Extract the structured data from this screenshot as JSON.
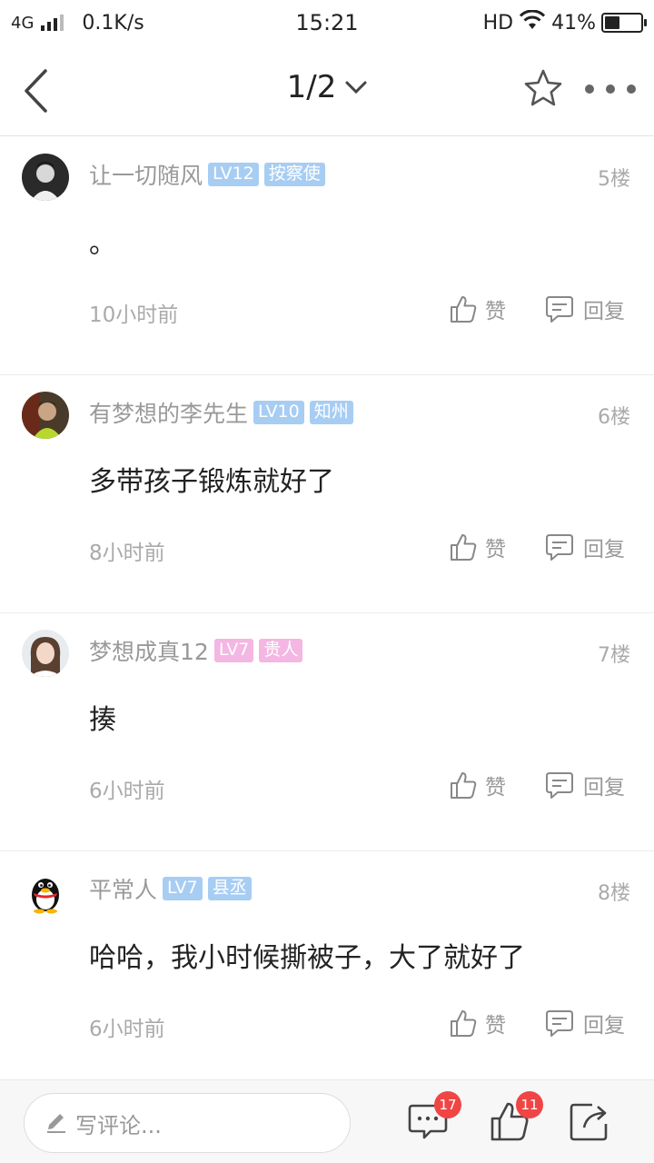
{
  "status_bar": {
    "network": "4G",
    "speed": "0.1K/s",
    "time": "15:21",
    "hd": "HD",
    "battery": "41%",
    "battery_level": 0.41
  },
  "header": {
    "page_indicator": "1/2"
  },
  "comments": [
    {
      "username": "让一切随风",
      "level": "LV12",
      "title": "按察使",
      "badge_color": "#a7cdf3",
      "floor": "5楼",
      "content": "。",
      "time": "10小时前",
      "like_label": "赞",
      "reply_label": "回复"
    },
    {
      "username": "有梦想的李先生",
      "level": "LV10",
      "title": "知州",
      "badge_color": "#a7cdf3",
      "floor": "6楼",
      "content": "多带孩子锻炼就好了",
      "time": "8小时前",
      "like_label": "赞",
      "reply_label": "回复"
    },
    {
      "username": "梦想成真12",
      "level": "LV7",
      "title": "贵人",
      "badge_color": "#f4b6e2",
      "floor": "7楼",
      "content": "揍",
      "time": "6小时前",
      "like_label": "赞",
      "reply_label": "回复"
    },
    {
      "username": "平常人",
      "level": "LV7",
      "title": "县丞",
      "badge_color": "#a7cdf3",
      "floor": "8楼",
      "content": "哈哈，我小时候撕被子，大了就好了",
      "time": "6小时前",
      "like_label": "赞",
      "reply_label": "回复"
    }
  ],
  "bottom_bar": {
    "comment_placeholder": "写评论...",
    "comment_count": "17",
    "like_count": "11"
  }
}
